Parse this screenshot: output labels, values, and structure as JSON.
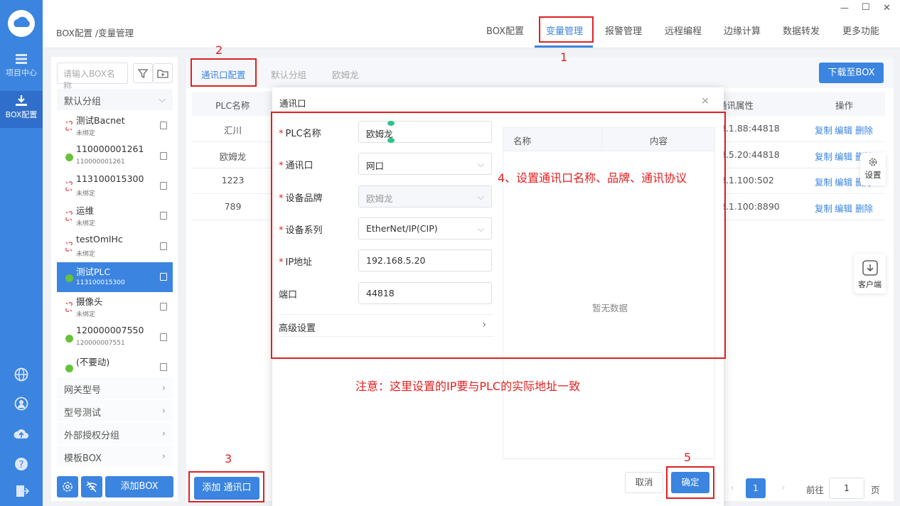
{
  "sidebar": {
    "items": [
      {
        "label": "项目中心",
        "icon": "grid-icon"
      },
      {
        "label": "BOX配置",
        "icon": "download-icon"
      }
    ],
    "bottom_icons": [
      "globe-icon",
      "user-icon",
      "cloud-upload-icon",
      "help-icon",
      "logout-icon"
    ]
  },
  "header": {
    "breadcrumb": "BOX配置 /变量管理",
    "tabs": [
      "BOX配置",
      "变量管理",
      "报警管理",
      "远程编程",
      "边缘计算",
      "数据转发",
      "更多功能"
    ],
    "active_tab": "变量管理"
  },
  "left_panel": {
    "search_placeholder": "请输入BOX名称",
    "default_group": "默认分组",
    "boxes": [
      {
        "name": "测试Bacnet",
        "sub": "未绑定",
        "status": "unbound"
      },
      {
        "name": "110000001261",
        "sub": "110000001261",
        "status": "online"
      },
      {
        "name": "113100015300",
        "sub": "未绑定",
        "status": "unbound"
      },
      {
        "name": "运维",
        "sub": "未绑定",
        "status": "unbound"
      },
      {
        "name": "testOmlHc",
        "sub": "未绑定",
        "status": "unbound"
      },
      {
        "name": "测试PLC",
        "sub": "113100015300",
        "status": "online"
      },
      {
        "name": "摄像头",
        "sub": "未绑定",
        "status": "unbound"
      },
      {
        "name": "120000007550",
        "sub": "120000007551",
        "status": "online"
      },
      {
        "name": "(不要动)",
        "sub": "",
        "status": "online"
      }
    ],
    "groups": [
      "网关型号",
      "型号测试",
      "外部授权分组",
      "模板BOX"
    ],
    "add_box": "添加BOX"
  },
  "main": {
    "tabs": [
      "通讯口配置",
      "默认分组",
      "欧姆龙"
    ],
    "download_btn": "下载至BOX",
    "table": {
      "col_plc": "PLC名称",
      "col_attr": "通讯属性",
      "col_ops": "操作",
      "rows": [
        {
          "plc": "汇川",
          "attr": "8.1.88:44818"
        },
        {
          "plc": "欧姆龙",
          "attr": "8.5.20:44818"
        },
        {
          "plc": "1223",
          "attr": "8.1.100:502"
        },
        {
          "plc": "789",
          "attr": "8.1.100:8890"
        }
      ],
      "ops": [
        "复制",
        "编辑",
        "删除"
      ]
    },
    "add_port": "添加 通讯口",
    "pagination": {
      "page": "1",
      "goto_label": "前往",
      "goto_value": "1",
      "page_suffix": "页"
    }
  },
  "float_tools": {
    "settings": "设置",
    "client": "客户端"
  },
  "dialog": {
    "title": "通讯口",
    "fields": [
      {
        "label": "PLC名称",
        "value": "欧姆龙",
        "required": true
      },
      {
        "label": "通讯口",
        "value": "网口",
        "required": true
      },
      {
        "label": "设备品牌",
        "value": "欧姆龙",
        "required": true
      },
      {
        "label": "设备系列",
        "value": "EtherNet/IP(CIP)",
        "required": true
      },
      {
        "label": "IP地址",
        "value": "192.168.5.20",
        "required": true
      },
      {
        "label": "端口",
        "value": "44818",
        "required": false
      }
    ],
    "advanced": "高级设置",
    "right_table": {
      "col_name": "名称",
      "col_content": "内容",
      "empty": "暂无数据"
    },
    "cancel": "取消",
    "confirm": "确定"
  },
  "annotations": {
    "n1": "1",
    "n2": "2",
    "n3": "3",
    "n5": "5",
    "step4": "4、设置通讯口名称、品牌、通讯协议",
    "note": "注意：这里设置的IP要与PLC的实际地址一致"
  },
  "window": {
    "minimize": "—",
    "maximize": "☐",
    "close": "✕"
  },
  "colors": {
    "accent": "#3b84e0",
    "annotation": "#e02020",
    "online": "#67c23a"
  }
}
